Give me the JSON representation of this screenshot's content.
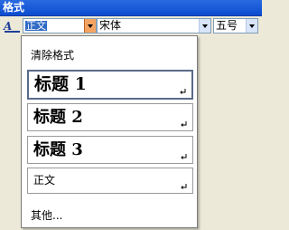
{
  "panel": {
    "title": "格式"
  },
  "toolbar": {
    "style_value": "正文",
    "font_value": "宋体",
    "size_value": "五号"
  },
  "dropdown": {
    "clear_label": "清除格式",
    "items": [
      {
        "label": "标题 1"
      },
      {
        "label": "标题 2"
      },
      {
        "label": "标题 3"
      },
      {
        "label": "正文"
      }
    ],
    "more_label": "其他..."
  }
}
